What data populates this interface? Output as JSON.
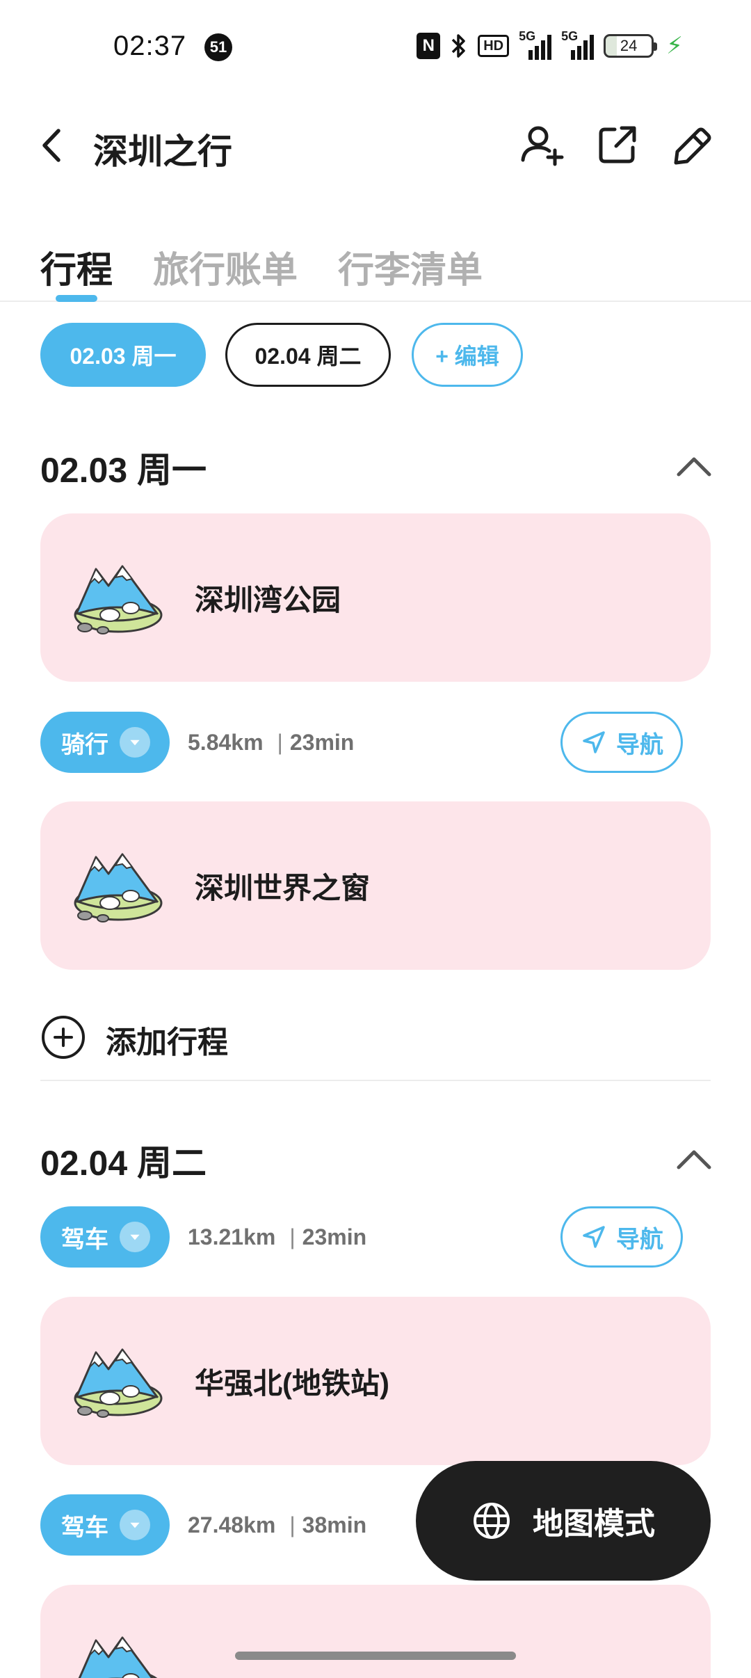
{
  "status_bar": {
    "time": "02:37",
    "notification_count": "51",
    "nfc": "N",
    "hd": "HD",
    "signal1_label": "5G",
    "signal2_label": "5G",
    "battery": "24"
  },
  "header": {
    "title": "深圳之行"
  },
  "tabs": [
    {
      "label": "行程",
      "active": true
    },
    {
      "label": "旅行账单",
      "active": false
    },
    {
      "label": "行李清单",
      "active": false
    }
  ],
  "date_chips": [
    {
      "label": "02.03 周一",
      "active": true
    },
    {
      "label": "02.04 周二",
      "active": false
    }
  ],
  "edit_chip_label": "+ 编辑",
  "days": [
    {
      "title": "02.03 周一",
      "places": [
        "深圳湾公园",
        "深圳世界之窗"
      ],
      "routes": [
        {
          "mode": "骑行",
          "distance": "5.84km",
          "sep": "|",
          "duration": "23min",
          "nav_label": "导航"
        }
      ],
      "add_label": "添加行程"
    },
    {
      "title": "02.04 周二",
      "places": [
        "华强北(地铁站)"
      ],
      "routes": [
        {
          "mode": "驾车",
          "distance": "13.21km",
          "sep": "|",
          "duration": "23min",
          "nav_label": "导航"
        },
        {
          "mode": "驾车",
          "distance": "27.48km",
          "sep": "|",
          "duration": "38min"
        }
      ]
    }
  ],
  "map_mode_label": "地图模式",
  "colors": {
    "accent": "#4db8ec",
    "card_bg": "#fde5ea",
    "dark_button": "#1f1f1f",
    "text": "#1c1c1c",
    "muted": "#b0b0b0"
  }
}
